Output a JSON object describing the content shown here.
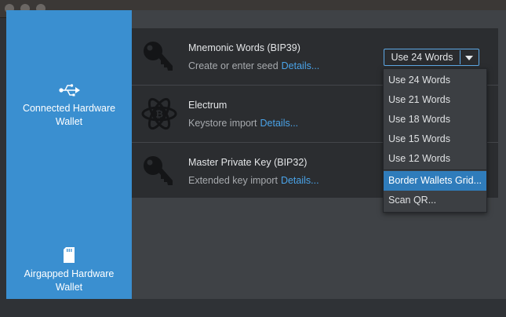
{
  "sidebar": {
    "items": [
      {
        "label_line1": "Connected Hardware",
        "label_line2": "Wallet",
        "icon": "usb-icon"
      },
      {
        "label_line1": "Airgapped Hardware",
        "label_line2": "Wallet",
        "icon": "sd-card-icon"
      }
    ]
  },
  "import_options": [
    {
      "title": "Mnemonic Words (BIP39)",
      "subtitle": "Create or enter seed",
      "link": "Details...",
      "icon": "key-icon"
    },
    {
      "title": "Electrum",
      "subtitle": "Keystore import",
      "link": "Details...",
      "icon": "electrum-icon"
    },
    {
      "title": "Master Private Key (BIP32)",
      "subtitle": "Extended key import",
      "link": "Details...",
      "icon": "key-icon"
    }
  ],
  "word_count_combo": {
    "selected": "Use 24 Words",
    "options": [
      "Use 24 Words",
      "Use 21 Words",
      "Use 18 Words",
      "Use 15 Words",
      "Use 12 Words",
      "Border Wallets Grid...",
      "Scan QR..."
    ],
    "highlighted": "Border Wallets Grid..."
  },
  "colors": {
    "sidebar": "#3a8fd0",
    "link": "#4aa3e8",
    "highlight": "#2f7cbb"
  }
}
